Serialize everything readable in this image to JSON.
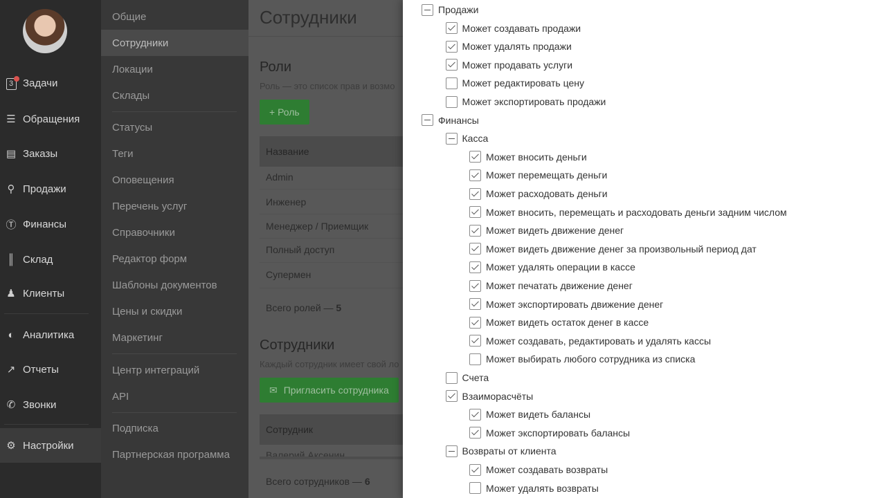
{
  "nav": {
    "task_count": "3",
    "items": [
      {
        "label": "Задачи",
        "icon": "tasks-icon"
      },
      {
        "label": "Обращения",
        "icon": "filter-icon"
      },
      {
        "label": "Заказы",
        "icon": "orders-icon"
      },
      {
        "label": "Продажи",
        "icon": "cart-icon"
      },
      {
        "label": "Финансы",
        "icon": "dollar-icon"
      },
      {
        "label": "Склад",
        "icon": "barcode-icon"
      },
      {
        "label": "Клиенты",
        "icon": "user-icon"
      },
      {
        "label": "Аналитика",
        "icon": "gauge-icon"
      },
      {
        "label": "Отчеты",
        "icon": "chart-icon"
      },
      {
        "label": "Звонки",
        "icon": "phone-icon"
      },
      {
        "label": "Настройки",
        "icon": "gear-icon"
      }
    ]
  },
  "menu": {
    "items": [
      "Общие",
      "Сотрудники",
      "Локации",
      "Склады",
      "Статусы",
      "Теги",
      "Оповещения",
      "Перечень услуг",
      "Справочники",
      "Редактор форм",
      "Шаблоны документов",
      "Цены и скидки",
      "Маркетинг",
      "Центр интеграций",
      "API",
      "Подписка",
      "Партнерская программа"
    ]
  },
  "content": {
    "page_title": "Сотрудники",
    "roles_title": "Роли",
    "roles_desc": "Роль — это список прав и возмо",
    "add_role_button": "+ Роль",
    "roles_header": "Название",
    "roles": [
      "Admin",
      "Инженер",
      "Менеджер / Приемщик",
      "Полный доступ",
      "Супермен"
    ],
    "roles_total_label": "Всего ролей — ",
    "roles_total_value": "5",
    "employees_title": "Сотрудники",
    "employees_desc": "Каждый сотрудник имеет свой ло",
    "invite_button": "Пригласить сотрудника",
    "employees_header": "Сотрудник",
    "employee_partial": "Валерий Аксенин",
    "employees_total_label": "Всего сотрудников — ",
    "employees_total_value": "6"
  },
  "permissions": [
    {
      "label": "Продажи",
      "state": "minus",
      "level": 0
    },
    {
      "label": "Может создавать продажи",
      "state": "checked",
      "level": 1
    },
    {
      "label": "Может удалять продажи",
      "state": "checked",
      "level": 1
    },
    {
      "label": "Может продавать услуги",
      "state": "checked",
      "level": 1
    },
    {
      "label": "Может редактировать цену",
      "state": "unchecked",
      "level": 1
    },
    {
      "label": "Может экспортировать продажи",
      "state": "unchecked",
      "level": 1
    },
    {
      "label": "Финансы",
      "state": "minus",
      "level": 0
    },
    {
      "label": "Касса",
      "state": "minus",
      "level": 1
    },
    {
      "label": "Может вносить деньги",
      "state": "checked",
      "level": 2
    },
    {
      "label": "Может перемещать деньги",
      "state": "checked",
      "level": 2
    },
    {
      "label": "Может расходовать деньги",
      "state": "checked",
      "level": 2
    },
    {
      "label": "Может вносить, перемещать и расходовать деньги задним числом",
      "state": "checked",
      "level": 2
    },
    {
      "label": "Может видеть движение денег",
      "state": "checked",
      "level": 2
    },
    {
      "label": "Может видеть движение денег за произвольный период дат",
      "state": "checked",
      "level": 2
    },
    {
      "label": "Может удалять операции в кассе",
      "state": "checked",
      "level": 2
    },
    {
      "label": "Может печатать движение денег",
      "state": "checked",
      "level": 2
    },
    {
      "label": "Может экспортировать движение денег",
      "state": "checked",
      "level": 2
    },
    {
      "label": "Может видеть остаток денег в кассе",
      "state": "checked",
      "level": 2
    },
    {
      "label": "Может создавать, редактировать и удалять кассы",
      "state": "checked",
      "level": 2
    },
    {
      "label": "Может выбирать любого сотрудника из списка",
      "state": "unchecked",
      "level": 2
    },
    {
      "label": "Счета",
      "state": "unchecked",
      "level": 1
    },
    {
      "label": "Взаиморасчёты",
      "state": "checked",
      "level": 1
    },
    {
      "label": "Может видеть балансы",
      "state": "checked",
      "level": 2
    },
    {
      "label": "Может экспортировать балансы",
      "state": "checked",
      "level": 2
    },
    {
      "label": "Возвраты от клиента",
      "state": "minus",
      "level": 1
    },
    {
      "label": "Может создавать возвраты",
      "state": "checked",
      "level": 2
    },
    {
      "label": "Может удалять возвраты",
      "state": "unchecked",
      "level": 2
    }
  ]
}
